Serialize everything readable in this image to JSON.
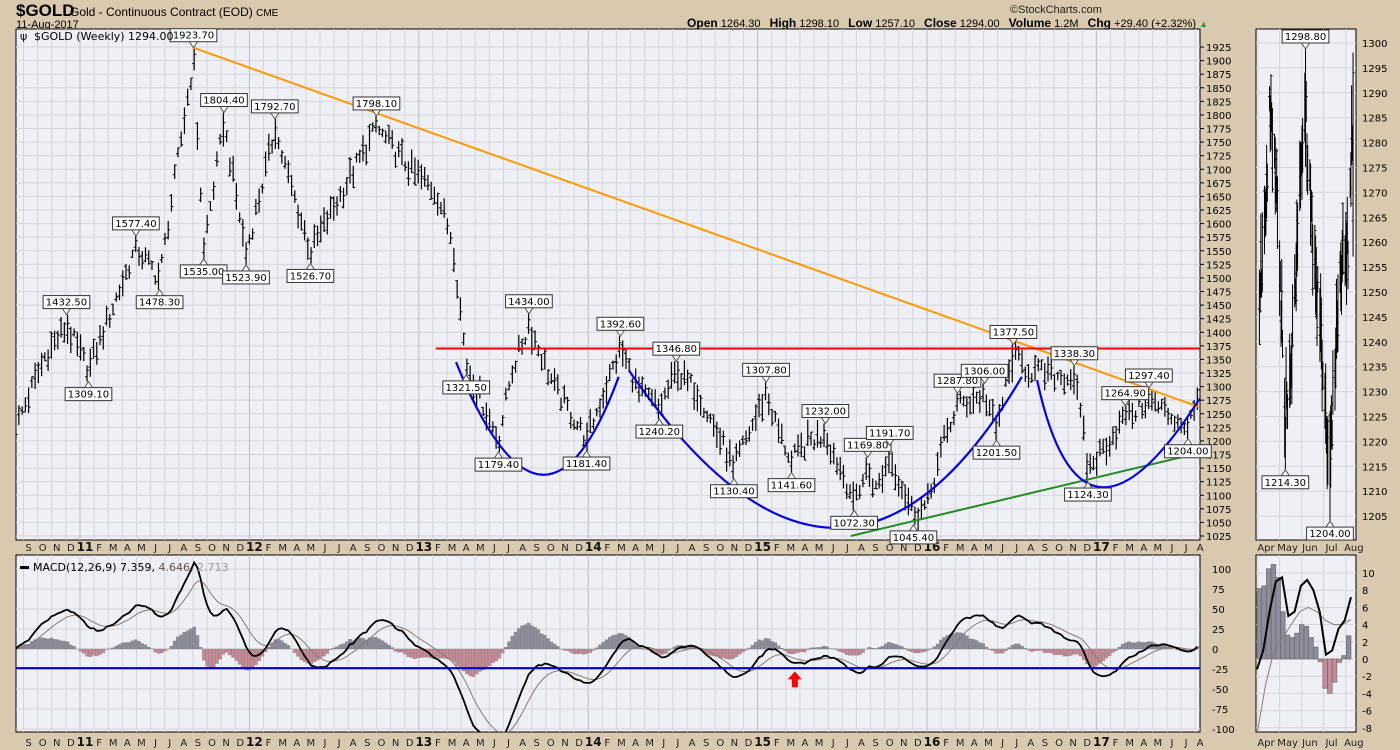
{
  "header": {
    "symbol": "$GOLD",
    "name": "Gold - Continuous Contract (EOD)",
    "exchange": "CME",
    "date": "11-Aug-2017",
    "copyright": "©StockCharts.com",
    "open_label": "Open",
    "open": "1264.30",
    "high_label": "High",
    "high": "1298.10",
    "low_label": "Low",
    "low": "1257.10",
    "close_label": "Close",
    "close": "1294.00",
    "volume_label": "Volume",
    "volume": "1.2M",
    "chg_label": "Chg",
    "chg": "+29.40 (+2.32%)",
    "chg_arrow": "▲"
  },
  "panel_title": "$GOLD (Weekly) 1294.00",
  "macd_title": {
    "name": "MACD(12,26,9)",
    "macd": "7.359,",
    "signal": "4.646,",
    "hist": "2.713"
  },
  "month_letters": [
    "J",
    "F",
    "M",
    "A",
    "M",
    "J",
    "J",
    "A",
    "S",
    "O",
    "N",
    "D"
  ],
  "colors": {
    "background": "#d9c9ae",
    "panel": "#eff0f5",
    "grid": "#d4d5dc",
    "trend_orange": "#ff9900",
    "resistance_red": "#ff0000",
    "support_green": "#228b22",
    "arc_blue": "#0000ee",
    "macd_line": "#000000",
    "signal_line": "#8a7a72",
    "hist_pos": "#8c8c9c",
    "hist_neg": "#c48a96",
    "arrow": "#ff0000"
  },
  "chart_data": [
    {
      "id": "main_price",
      "type": "ohlc",
      "title": "$GOLD (Weekly) 1294.00",
      "x_range": [
        2010.62,
        2017.61
      ],
      "ylim": [
        1025,
        1925
      ],
      "y_tick_step": 25,
      "x_year_labels": [
        "11",
        "12",
        "13",
        "14",
        "15",
        "16",
        "17"
      ],
      "last_bar": {
        "open": 1264.3,
        "high": 1298.1,
        "low": 1257.1,
        "close": 1294.0
      },
      "path_anchors": [
        [
          2010.62,
          1225
        ],
        [
          2010.8,
          1360
        ],
        [
          2012.95,
          1700
        ],
        [
          2013.1,
          1660
        ],
        [
          2013.2,
          1570
        ],
        [
          2013.55,
          1330
        ],
        [
          2013.8,
          1300
        ],
        [
          2014.3,
          1290
        ],
        [
          2014.65,
          1290
        ],
        [
          2014.75,
          1220
        ],
        [
          2015.12,
          1220
        ],
        [
          2015.3,
          1200
        ],
        [
          2015.7,
          1110
        ],
        [
          2016.0,
          1080
        ],
        [
          2016.1,
          1200
        ],
        [
          2016.6,
          1330
        ],
        [
          2016.75,
          1320
        ],
        [
          2016.92,
          1220
        ],
        [
          2017.05,
          1190
        ],
        [
          2017.42,
          1250
        ],
        [
          2017.61,
          1280
        ]
      ],
      "labels": [
        {
          "t": 2010.92,
          "text": "1432.50",
          "value": 1432.5,
          "pos": "above"
        },
        {
          "t": 2011.05,
          "text": "1309.10",
          "value": 1309.1,
          "pos": "below"
        },
        {
          "t": 2011.33,
          "text": "1577.40",
          "value": 1577.4,
          "pos": "above"
        },
        {
          "t": 2011.47,
          "text": "1478.30",
          "value": 1478.3,
          "pos": "below"
        },
        {
          "t": 2011.67,
          "text": "1923.70",
          "value": 1923.7,
          "pos": "above"
        },
        {
          "t": 2011.73,
          "text": "1535.00",
          "value": 1535.0,
          "pos": "below"
        },
        {
          "t": 2011.85,
          "text": "1804.40",
          "value": 1804.4,
          "pos": "above"
        },
        {
          "t": 2011.98,
          "text": "1523.90",
          "value": 1523.9,
          "pos": "below"
        },
        {
          "t": 2012.15,
          "text": "1792.70",
          "value": 1792.7,
          "pos": "above"
        },
        {
          "t": 2012.36,
          "text": "1526.70",
          "value": 1526.7,
          "pos": "below"
        },
        {
          "t": 2012.75,
          "text": "1798.10",
          "value": 1798.1,
          "pos": "above"
        },
        {
          "t": 2013.28,
          "text": "1321.50",
          "value": 1321.5,
          "pos": "below"
        },
        {
          "t": 2013.47,
          "text": "1179.40",
          "value": 1179.4,
          "pos": "below"
        },
        {
          "t": 2013.65,
          "text": "1434.00",
          "value": 1434.0,
          "pos": "above"
        },
        {
          "t": 2013.99,
          "text": "1181.40",
          "value": 1181.4,
          "pos": "below"
        },
        {
          "t": 2014.19,
          "text": "1392.60",
          "value": 1392.6,
          "pos": "above"
        },
        {
          "t": 2014.42,
          "text": "1240.20",
          "value": 1240.2,
          "pos": "below"
        },
        {
          "t": 2014.52,
          "text": "1346.80",
          "value": 1346.8,
          "pos": "above"
        },
        {
          "t": 2014.86,
          "text": "1130.40",
          "value": 1130.4,
          "pos": "below"
        },
        {
          "t": 2015.05,
          "text": "1307.80",
          "value": 1307.8,
          "pos": "above"
        },
        {
          "t": 2015.2,
          "text": "1141.60",
          "value": 1141.6,
          "pos": "below"
        },
        {
          "t": 2015.4,
          "text": "1232.00",
          "value": 1232.0,
          "pos": "above"
        },
        {
          "t": 2015.57,
          "text": "1072.30",
          "value": 1072.3,
          "pos": "below"
        },
        {
          "t": 2015.65,
          "text": "1169.80",
          "value": 1169.8,
          "pos": "above"
        },
        {
          "t": 2015.78,
          "text": "1191.70",
          "value": 1191.7,
          "pos": "above"
        },
        {
          "t": 2015.92,
          "text": "1045.40",
          "value": 1045.4,
          "pos": "below"
        },
        {
          "t": 2016.18,
          "text": "1287.80",
          "value": 1287.8,
          "pos": "above"
        },
        {
          "t": 2016.34,
          "text": "1306.00",
          "value": 1306.0,
          "pos": "above"
        },
        {
          "t": 2016.41,
          "text": "1201.50",
          "value": 1201.5,
          "pos": "below"
        },
        {
          "t": 2016.51,
          "text": "1377.50",
          "value": 1377.5,
          "pos": "above"
        },
        {
          "t": 2016.87,
          "text": "1338.30",
          "value": 1338.3,
          "pos": "above"
        },
        {
          "t": 2016.95,
          "text": "1124.30",
          "value": 1124.3,
          "pos": "below"
        },
        {
          "t": 2017.17,
          "text": "1264.90",
          "value": 1264.9,
          "pos": "above"
        },
        {
          "t": 2017.31,
          "text": "1297.40",
          "value": 1297.4,
          "pos": "above"
        },
        {
          "t": 2017.54,
          "text": "1204.00",
          "value": 1204.0,
          "pos": "below"
        }
      ],
      "trendlines": [
        {
          "name": "downtrend",
          "color": "orange",
          "from": [
            2011.67,
            1923.7
          ],
          "to": [
            2017.61,
            1262
          ]
        },
        {
          "name": "resistance",
          "color": "red",
          "from": [
            2013.1,
            1370
          ],
          "to": [
            2017.61,
            1370
          ]
        },
        {
          "name": "uptrend",
          "color": "green",
          "from": [
            2015.55,
            1025
          ],
          "to": [
            2017.61,
            1178
          ]
        }
      ],
      "arcs": [
        {
          "start": [
            2013.22,
            1345
          ],
          "bottom": [
            2013.72,
            1138
          ],
          "end": [
            2014.18,
            1318
          ]
        },
        {
          "start": [
            2014.24,
            1330
          ],
          "bottom": [
            2015.45,
            1040
          ],
          "end": [
            2016.56,
            1318
          ]
        },
        {
          "start": [
            2016.65,
            1312
          ],
          "bottom": [
            2017.02,
            1115
          ],
          "end": [
            2017.61,
            1278
          ]
        }
      ]
    },
    {
      "id": "main_macd",
      "type": "macd",
      "params": [
        12,
        26,
        9
      ],
      "readout": [
        7.359,
        4.646,
        2.713
      ],
      "ylim": [
        -100,
        100
      ],
      "y_ticks": [
        100,
        75,
        50,
        25,
        0,
        -25,
        -50,
        -75,
        -100
      ],
      "horizontal_line": -24,
      "arrow": {
        "t": 2015.22,
        "value": -38,
        "direction": "up"
      }
    },
    {
      "id": "side_price",
      "type": "ohlc",
      "period": "daily",
      "x_month_labels": [
        "Apr",
        "May",
        "Jun",
        "Jul",
        "Aug"
      ],
      "ylim": [
        1202,
        1302
      ],
      "y_ticks": [
        1300,
        1295,
        1290,
        1285,
        1280,
        1275,
        1270,
        1265,
        1260,
        1255,
        1250,
        1245,
        1240,
        1235,
        1230,
        1225,
        1220,
        1215,
        1210,
        1205
      ],
      "path_anchors": [
        [
          2,
          1250
        ],
        [
          10,
          1262
        ],
        [
          16,
          1285
        ],
        [
          22,
          1280
        ],
        [
          27,
          1266
        ],
        [
          38,
          1226
        ],
        [
          45,
          1232
        ],
        [
          55,
          1262
        ],
        [
          66,
          1286
        ],
        [
          75,
          1262
        ],
        [
          85,
          1245
        ],
        [
          100,
          1214
        ],
        [
          108,
          1240
        ],
        [
          115,
          1256
        ],
        [
          125,
          1260
        ],
        [
          132,
          1288
        ]
      ],
      "labels": [
        {
          "d": 66,
          "text": "1298.80",
          "value": 1298.8,
          "pos": "above"
        },
        {
          "d": 38,
          "text": "1214.30",
          "value": 1214.3,
          "pos": "below"
        },
        {
          "d": 100,
          "text": "1204.00",
          "value": 1204.0,
          "pos": "below"
        }
      ]
    },
    {
      "id": "side_macd",
      "type": "macd",
      "ylim": [
        -9,
        11
      ],
      "y_ticks": [
        10,
        8,
        6,
        4,
        2,
        0,
        -2,
        -4,
        -6,
        -8
      ],
      "histogram": [
        8.2,
        8.5,
        10.5,
        11,
        9.5,
        5.5,
        2.8,
        2.5,
        3,
        4,
        3.8,
        2.5,
        1.4,
        -0.3,
        -3.4,
        -4,
        -2.7,
        -0.4,
        0.4,
        2.7
      ],
      "macd": [
        -1.2,
        1,
        5.5,
        9,
        9.5,
        5,
        5.5,
        8.5,
        9.2,
        8,
        5.5,
        0.5,
        1,
        3.5,
        4.5,
        7.2
      ],
      "signal": [
        -8.8,
        -3,
        1,
        2.5,
        4,
        5.5,
        6,
        5.5,
        4.5,
        4,
        4,
        4.6
      ]
    }
  ]
}
